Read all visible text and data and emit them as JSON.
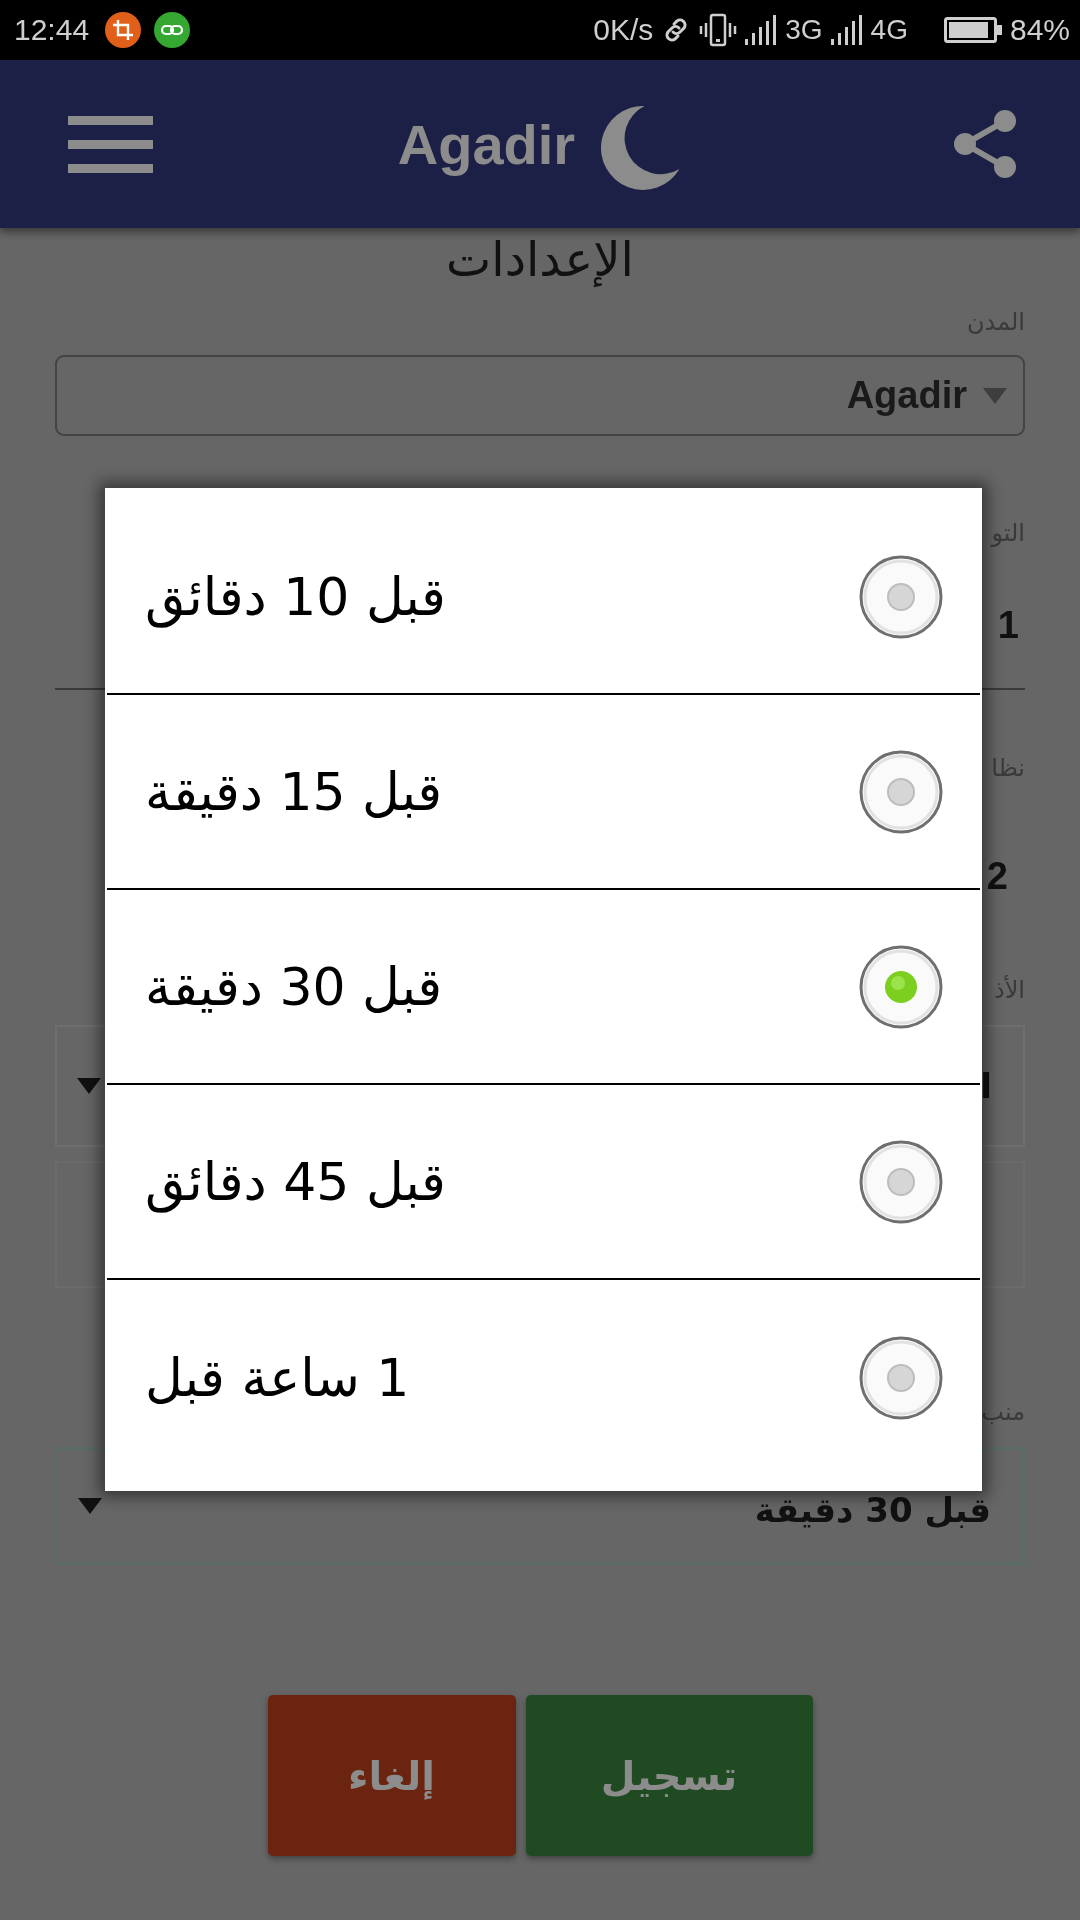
{
  "status_bar": {
    "time": "12:44",
    "net_speed": "0K/s",
    "network_1": "3G",
    "network_2": "4G",
    "battery": "84%"
  },
  "app_bar": {
    "title": "Agadir"
  },
  "page": {
    "title": "الإعدادات",
    "fields": [
      {
        "kind": "select",
        "label": "المدن",
        "value": "Agadir"
      },
      {
        "kind": "input",
        "label": "التو",
        "value": "1"
      },
      {
        "kind": "value",
        "label": "نظا",
        "value": "2"
      },
      {
        "kind": "spinner",
        "label": "الأذ",
        "value": "ا",
        "focused": false
      },
      {
        "kind": "blank"
      },
      {
        "kind": "spinner",
        "label": "منب",
        "value": "قبل 30 دقيقة",
        "focused": true
      }
    ],
    "buttons": [
      {
        "kind": "save",
        "label": "تسجيل"
      },
      {
        "kind": "cancel",
        "label": "إلغاء"
      }
    ]
  },
  "dialog": {
    "options": [
      {
        "label": "قبل 10 دقائق",
        "selected": false
      },
      {
        "label": "قبل 15 دقيقة",
        "selected": false
      },
      {
        "label": "قبل 30 دقيقة",
        "selected": true
      },
      {
        "label": "قبل 45 دقائق",
        "selected": false
      },
      {
        "label": "1 ساعة قبل",
        "selected": false
      }
    ]
  }
}
